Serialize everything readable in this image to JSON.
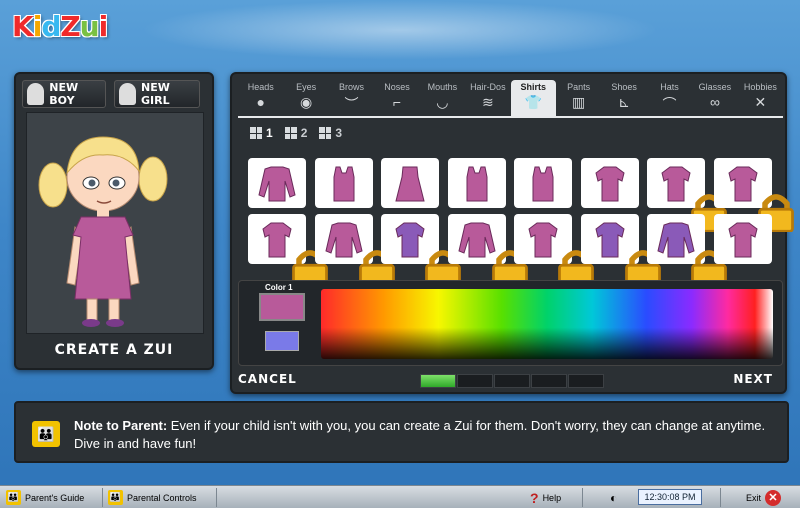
{
  "app": {
    "logo_text": "KidZui",
    "logo_colors": [
      "#f02a2a",
      "#f6a800",
      "#38b8f0",
      "#f02a2a",
      "#7ac142",
      "#f02a2a"
    ]
  },
  "left_panel": {
    "new_boy_label": "NEW BOY",
    "new_girl_label": "NEW GIRL",
    "create_label": "CREATE A ZUI"
  },
  "categories": [
    {
      "label": "Heads",
      "icon": "head-icon",
      "glyph": "●"
    },
    {
      "label": "Eyes",
      "icon": "eye-icon",
      "glyph": "◉"
    },
    {
      "label": "Brows",
      "icon": "brow-icon",
      "glyph": "︶"
    },
    {
      "label": "Noses",
      "icon": "nose-icon",
      "glyph": "⌐"
    },
    {
      "label": "Mouths",
      "icon": "mouth-icon",
      "glyph": "◡"
    },
    {
      "label": "Hair-Dos",
      "icon": "hair-icon",
      "glyph": "≋"
    },
    {
      "label": "Shirts",
      "icon": "shirt-icon",
      "glyph": "👕",
      "active": true
    },
    {
      "label": "Pants",
      "icon": "pants-icon",
      "glyph": "▥"
    },
    {
      "label": "Shoes",
      "icon": "shoes-icon",
      "glyph": "⊾"
    },
    {
      "label": "Hats",
      "icon": "hat-icon",
      "glyph": "⌒"
    },
    {
      "label": "Glasses",
      "icon": "glasses-icon",
      "glyph": "∞"
    },
    {
      "label": "Hobbies",
      "icon": "hobby-icon",
      "glyph": "✕"
    }
  ],
  "pages": [
    "1",
    "2",
    "3"
  ],
  "items": [
    {
      "name": "plaid-shirt",
      "locked": false
    },
    {
      "name": "tank-top",
      "locked": false
    },
    {
      "name": "dress",
      "locked": false
    },
    {
      "name": "sleeveless-top",
      "locked": false
    },
    {
      "name": "tank-top-2",
      "locked": false
    },
    {
      "name": "tshirt",
      "locked": false
    },
    {
      "name": "tshirt-2",
      "locked": true
    },
    {
      "name": "tshirt-3",
      "locked": true
    },
    {
      "name": "collar-shirt",
      "locked": true
    },
    {
      "name": "long-sleeve-shirt",
      "locked": true
    },
    {
      "name": "striped-shirt",
      "locked": true
    },
    {
      "name": "long-sleeve-shirt-2",
      "locked": true
    },
    {
      "name": "printed-shirt",
      "locked": true
    },
    {
      "name": "vest-shirt",
      "locked": true
    },
    {
      "name": "layered-shirt",
      "locked": true
    },
    {
      "name": "tshirt-4",
      "locked": false
    }
  ],
  "color_picker": {
    "label": "Color 1",
    "primary": "#b85a9a",
    "secondary": "#7a7ae8"
  },
  "nav": {
    "cancel_label": "CANCEL",
    "next_label": "NEXT",
    "progress_done": 1,
    "progress_total": 5
  },
  "note": {
    "title": "Note to Parent:",
    "body": " Even if your child isn't with you, you can create a Zui for them.  Don't worry, they can change at anytime. Dive in and have fun!"
  },
  "taskbar": {
    "parents_guide": "Parent's Guide",
    "parental_controls": "Parental Controls",
    "help": "Help",
    "clock": "12:30:08 PM",
    "exit": "Exit"
  }
}
